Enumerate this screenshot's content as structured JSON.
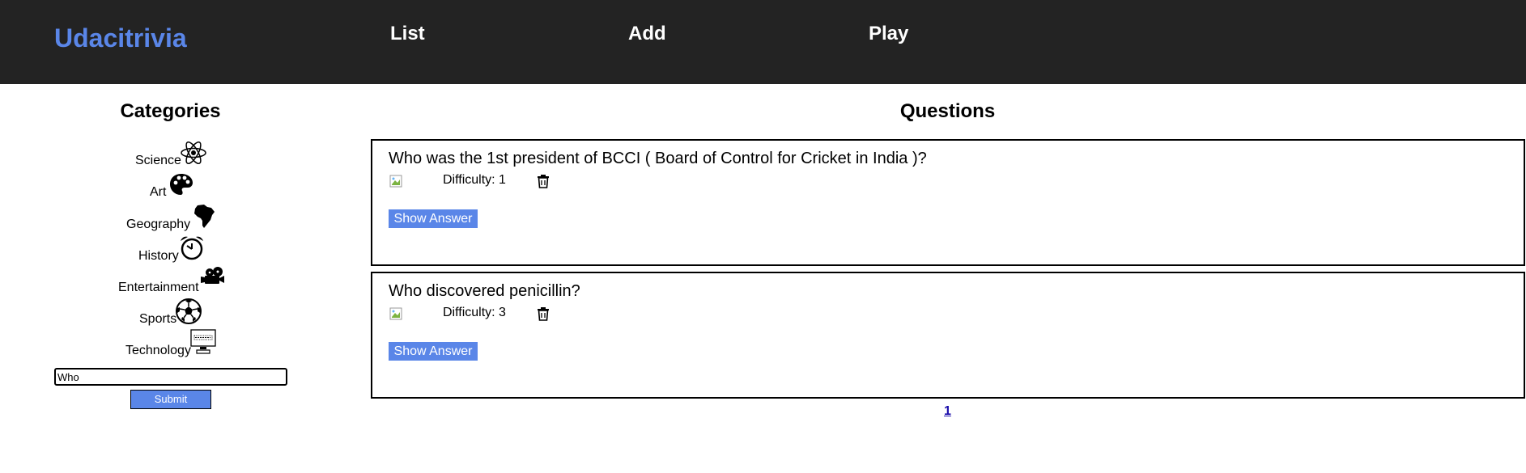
{
  "header": {
    "brand": "Udacitrivia",
    "nav": [
      {
        "label": "List"
      },
      {
        "label": "Add"
      },
      {
        "label": "Play"
      }
    ]
  },
  "sidebar": {
    "heading": "Categories",
    "categories": [
      {
        "label": "Science",
        "icon": "atom-icon"
      },
      {
        "label": "Art",
        "icon": "palette-icon"
      },
      {
        "label": "Geography",
        "icon": "africa-map-icon"
      },
      {
        "label": "History",
        "icon": "alarm-clock-icon"
      },
      {
        "label": "Entertainment",
        "icon": "film-camera-icon"
      },
      {
        "label": "Sports",
        "icon": "soccer-ball-icon"
      },
      {
        "label": "Technology",
        "icon": "computer-monitor-icon"
      }
    ],
    "search": {
      "value": "Who"
    },
    "submit_label": "Submit"
  },
  "main": {
    "heading": "Questions",
    "questions": [
      {
        "text": "Who was the 1st president of BCCI ( Board of Control for Cricket in India )?",
        "difficulty": "Difficulty: 1",
        "show_answer_label": "Show Answer"
      },
      {
        "text": "Who discovered penicillin?",
        "difficulty": "Difficulty: 3",
        "show_answer_label": "Show Answer"
      }
    ],
    "pagination": [
      "1"
    ]
  },
  "colors": {
    "header_bg": "#232323",
    "brand": "#5a86e8",
    "button_bg": "#5a86e8",
    "link": "#1a0dab"
  }
}
